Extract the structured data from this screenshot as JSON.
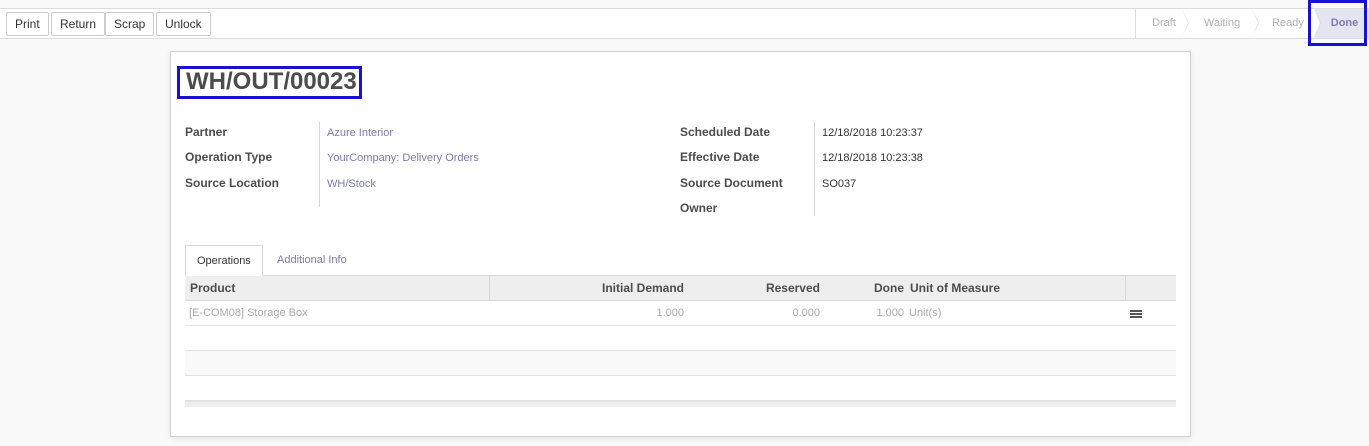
{
  "toolbar": {
    "print_label": "Print",
    "return_label": "Return",
    "scrap_label": "Scrap",
    "unlock_label": "Unlock"
  },
  "stages": {
    "draft": "Draft",
    "waiting": "Waiting",
    "ready": "Ready",
    "done": "Done",
    "active": "Done"
  },
  "record": {
    "name": "WH/OUT/00023"
  },
  "fields": {
    "partner_label": "Partner",
    "partner_value": "Azure Interior",
    "operation_type_label": "Operation Type",
    "operation_type_value": "YourCompany: Delivery Orders",
    "source_location_label": "Source Location",
    "source_location_value": "WH/Stock",
    "scheduled_date_label": "Scheduled Date",
    "scheduled_date_value": "12/18/2018 10:23:37",
    "effective_date_label": "Effective Date",
    "effective_date_value": "12/18/2018 10:23:38",
    "source_document_label": "Source Document",
    "source_document_value": "SO037",
    "owner_label": "Owner",
    "owner_value": ""
  },
  "tabs": {
    "operations": "Operations",
    "additional_info": "Additional Info"
  },
  "table": {
    "headers": {
      "product": "Product",
      "initial_demand": "Initial Demand",
      "reserved": "Reserved",
      "done": "Done",
      "uom": "Unit of Measure"
    },
    "rows": [
      {
        "product": "[E-COM08] Storage Box",
        "initial_demand": "1.000",
        "reserved": "0.000",
        "done": "1.000",
        "uom": "Unit(s)"
      }
    ]
  },
  "icons": {
    "row_detail": "list-icon"
  },
  "colors": {
    "link": "#7c7bad",
    "highlight": "#1a10d2",
    "active_stage_bg": "#e3e6f0"
  }
}
